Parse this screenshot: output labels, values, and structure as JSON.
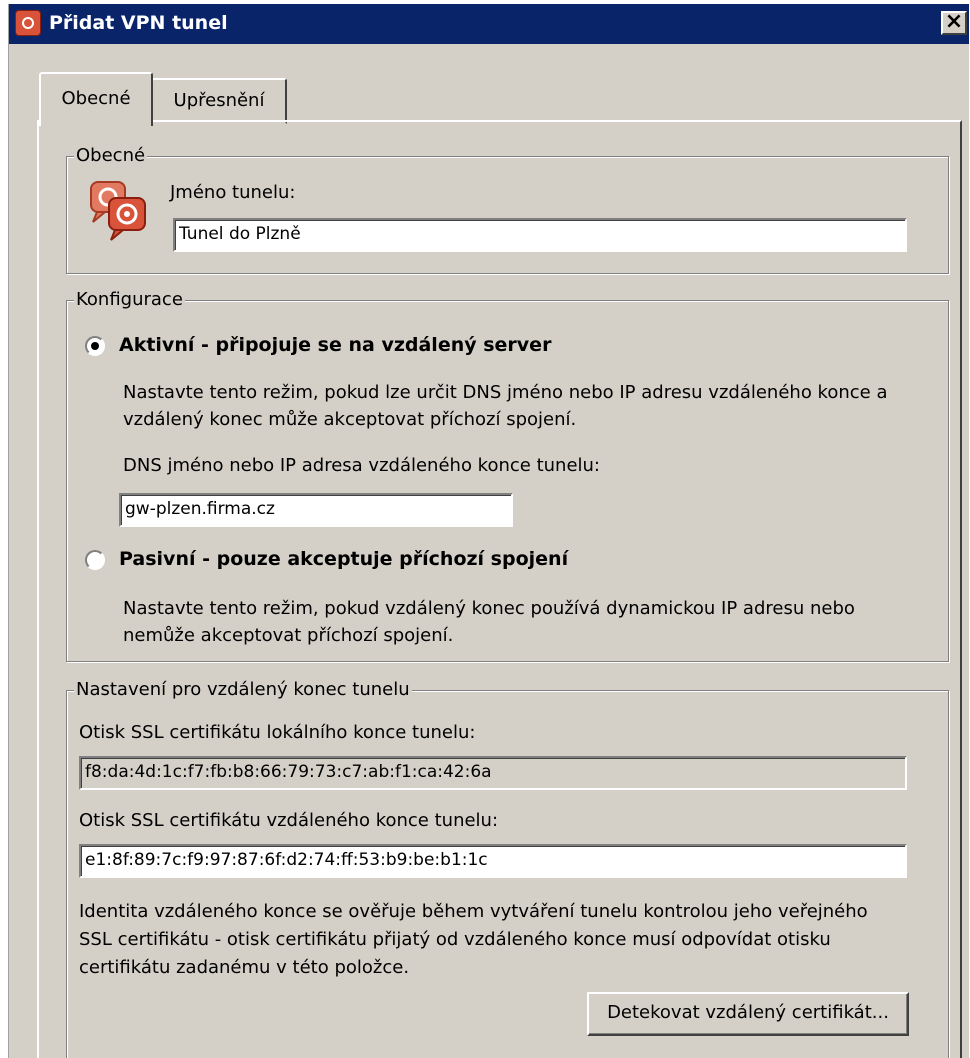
{
  "window": {
    "title": "Přidat VPN tunel",
    "close_glyph": "×"
  },
  "tabs": [
    {
      "label": "Obecné",
      "active": true
    },
    {
      "label": "Upřesnění",
      "active": false
    }
  ],
  "general_group": {
    "label": "Obecné",
    "icon": "vpn-tunnel-icon",
    "name_label": "Jméno tunelu:",
    "name_value": "Tunel do Plzně"
  },
  "config_group": {
    "label": "Konfigurace",
    "active_option": {
      "label": "Aktivní - připojuje se na vzdálený server",
      "checked": true,
      "desc_line1": "Nastavte tento režim, pokud lze určit DNS jméno nebo IP adresu vzdáleného konce a",
      "desc_line2": "vzdálený konec může akceptovat příchozí spojení.",
      "host_label": "DNS jméno nebo IP adresa vzdáleného konce tunelu:",
      "host_value": "gw-plzen.firma.cz"
    },
    "passive_option": {
      "label": "Pasivní - pouze akceptuje příchozí spojení",
      "checked": false,
      "desc_line1": "Nastavte tento režim, pokud vzdálený konec používá dynamickou IP adresu nebo",
      "desc_line2": "nemůže akceptovat příchozí spojení."
    }
  },
  "remote_group": {
    "label": "Nastavení pro vzdálený konec tunelu",
    "local_fp_label": "Otisk SSL certifikátu lokálního konce tunelu:",
    "local_fp_value": "f8:da:4d:1c:f7:fb:b8:66:79:73:c7:ab:f1:ca:42:6a",
    "remote_fp_label": "Otisk SSL certifikátu vzdáleného konce tunelu:",
    "remote_fp_value": "e1:8f:89:7c:f9:97:87:6f:d2:74:ff:53:b9:be:b1:1c",
    "info_line1": "Identita vzdáleného konce se ověřuje během vytváření tunelu kontrolou jeho veřejného",
    "info_line2": "SSL certifikátu - otisk certifikátu přijatý od vzdáleného konce musí odpovídat otisku",
    "info_line3": "certifikátu zadanému v této položce.",
    "detect_button": "Detekovat vzdálený certifikát..."
  },
  "colors": {
    "titlebar": "#0a246a",
    "face": "#d4d0c8",
    "icon_red": "#d9533a"
  }
}
